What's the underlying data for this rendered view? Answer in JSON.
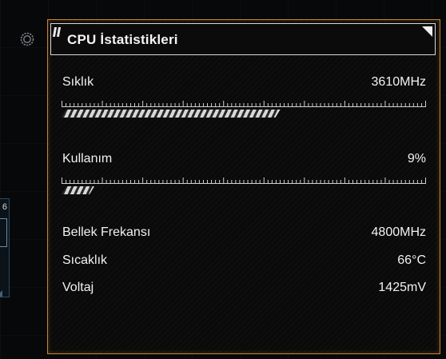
{
  "panel": {
    "title": "CPU İstatistikleri"
  },
  "sidebar": {
    "number": "6"
  },
  "stats": {
    "frequency": {
      "label": "Sıklık",
      "value": "3610MHz",
      "bar_fraction": 0.6
    },
    "usage": {
      "label": "Kullanım",
      "value": "9%",
      "bar_fraction": 0.09
    },
    "memory_frequency": {
      "label": "Bellek Frekansı",
      "value": "4800MHz"
    },
    "temperature": {
      "label": "Sıcaklık",
      "value": "66°C"
    },
    "voltage": {
      "label": "Voltaj",
      "value": "1425mV"
    }
  },
  "colors": {
    "accent_border": "#c8832f",
    "text": "#f2f2f2",
    "bar": "#e9e9e9"
  },
  "icons": {
    "settings": "gear-icon",
    "corner": "corner-marker-icon"
  }
}
